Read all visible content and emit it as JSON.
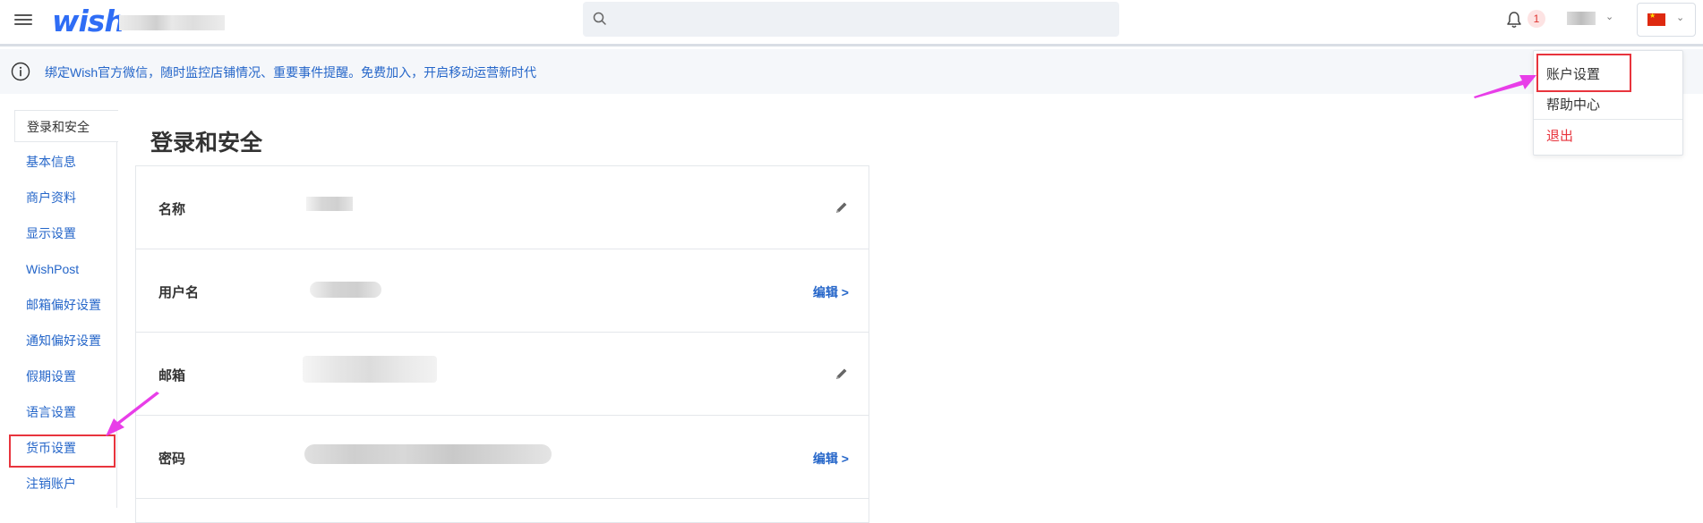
{
  "header": {
    "logo_text": "wish",
    "search_placeholder": "",
    "notification_count": "1"
  },
  "notice": {
    "text": "绑定Wish官方微信，随时监控店铺情况、重要事件提醒。免费加入，开启移动运营新时代"
  },
  "sidebar": {
    "items": [
      {
        "label": "登录和安全",
        "active": true
      },
      {
        "label": "基本信息"
      },
      {
        "label": "商户资料"
      },
      {
        "label": "显示设置"
      },
      {
        "label": "WishPost"
      },
      {
        "label": "邮箱偏好设置"
      },
      {
        "label": "通知偏好设置"
      },
      {
        "label": "假期设置"
      },
      {
        "label": "语言设置"
      },
      {
        "label": "货币设置"
      },
      {
        "label": "注销账户"
      }
    ]
  },
  "main": {
    "title": "登录和安全",
    "rows": [
      {
        "label": "名称",
        "action": "pencil"
      },
      {
        "label": "用户名",
        "action": "编辑 >"
      },
      {
        "label": "邮箱",
        "action": "pencil"
      },
      {
        "label": "密码",
        "action": "编辑 >"
      }
    ]
  },
  "dropdown": {
    "items": [
      "账户设置",
      "帮助中心",
      "退出"
    ]
  },
  "colors": {
    "brand": "#2f6df5",
    "link": "#2566c9",
    "danger": "#e8343d",
    "annotation_arrow": "#e83ee8"
  }
}
